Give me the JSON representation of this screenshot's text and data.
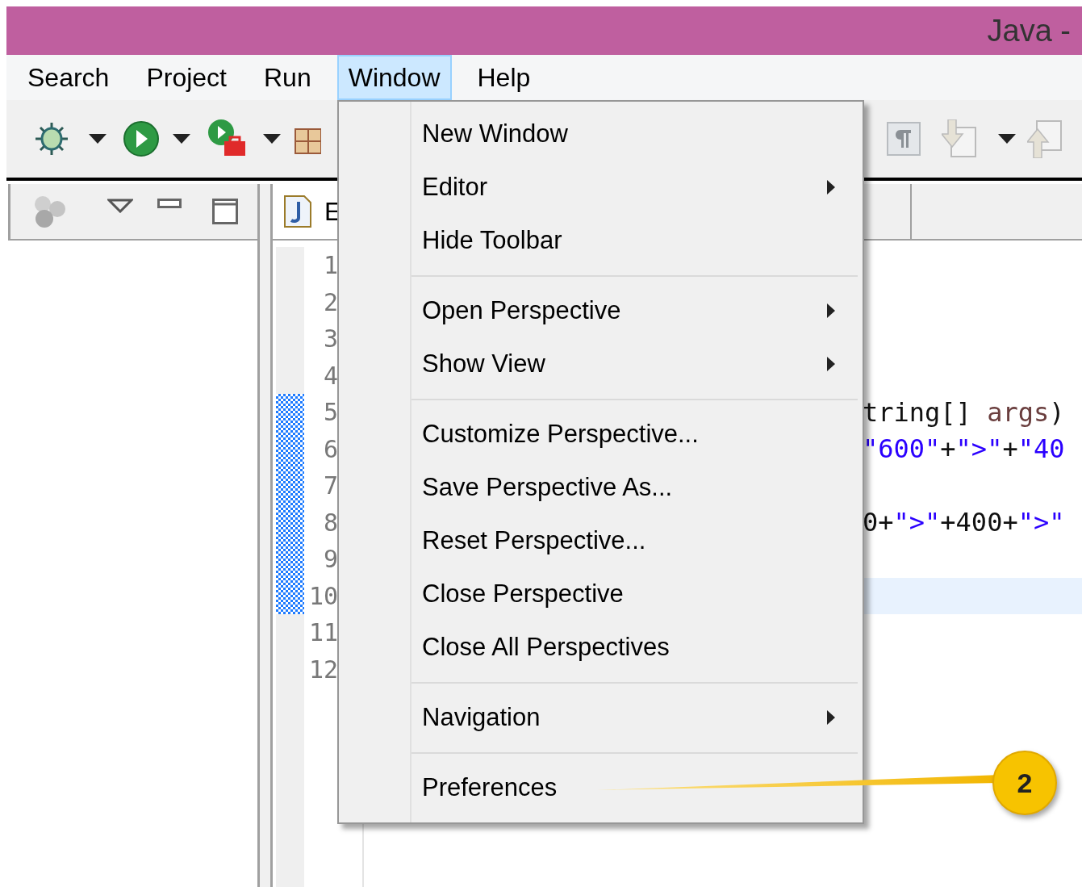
{
  "window": {
    "title": "Java -"
  },
  "menu_bar": [
    {
      "label": "Search",
      "selected": false
    },
    {
      "label": "Project",
      "selected": false
    },
    {
      "label": "Run",
      "selected": false
    },
    {
      "label": "Window",
      "selected": true
    },
    {
      "label": "Help",
      "selected": false
    }
  ],
  "editor": {
    "tab": {
      "label": "E"
    },
    "lines": [
      {
        "number": "1",
        "current": false
      },
      {
        "number": "2",
        "current": false
      },
      {
        "number": "3",
        "current": false
      },
      {
        "number": "4",
        "current": false
      },
      {
        "number": "5",
        "current": false,
        "code": [
          {
            "kind": "plain",
            "text": "tring[] "
          },
          {
            "kind": "param",
            "text": "args"
          },
          {
            "kind": "plain",
            "text": ")"
          }
        ]
      },
      {
        "number": "6",
        "current": false,
        "code": [
          {
            "kind": "string",
            "text": "\"600\""
          },
          {
            "kind": "plain",
            "text": "+"
          },
          {
            "kind": "string",
            "text": "\">\""
          },
          {
            "kind": "plain",
            "text": "+"
          },
          {
            "kind": "string",
            "text": "\"40"
          }
        ]
      },
      {
        "number": "7",
        "current": false
      },
      {
        "number": "8",
        "current": false,
        "code": [
          {
            "kind": "plain",
            "text": "0+"
          },
          {
            "kind": "string",
            "text": "\">\""
          },
          {
            "kind": "plain",
            "text": "+400+"
          },
          {
            "kind": "string",
            "text": "\">\""
          }
        ]
      },
      {
        "number": "9",
        "current": false
      },
      {
        "number": "10",
        "current": true
      },
      {
        "number": "11",
        "current": false
      },
      {
        "number": "12",
        "current": false
      }
    ]
  },
  "window_menu": {
    "groups": [
      {
        "items": [
          {
            "label": "New Window",
            "submenu": false
          },
          {
            "label": "Editor",
            "submenu": true
          },
          {
            "label": "Hide Toolbar",
            "submenu": false
          }
        ]
      },
      {
        "items": [
          {
            "label": "Open Perspective",
            "submenu": true
          },
          {
            "label": "Show View",
            "submenu": true
          }
        ]
      },
      {
        "items": [
          {
            "label": "Customize Perspective...",
            "submenu": false
          },
          {
            "label": "Save Perspective As...",
            "submenu": false
          },
          {
            "label": "Reset Perspective...",
            "submenu": false
          },
          {
            "label": "Close Perspective",
            "submenu": false
          },
          {
            "label": "Close All Perspectives",
            "submenu": false
          }
        ]
      },
      {
        "items": [
          {
            "label": "Navigation",
            "submenu": true
          }
        ]
      },
      {
        "items": [
          {
            "label": "Preferences",
            "submenu": false
          }
        ]
      }
    ]
  },
  "callout": {
    "number": "2"
  }
}
